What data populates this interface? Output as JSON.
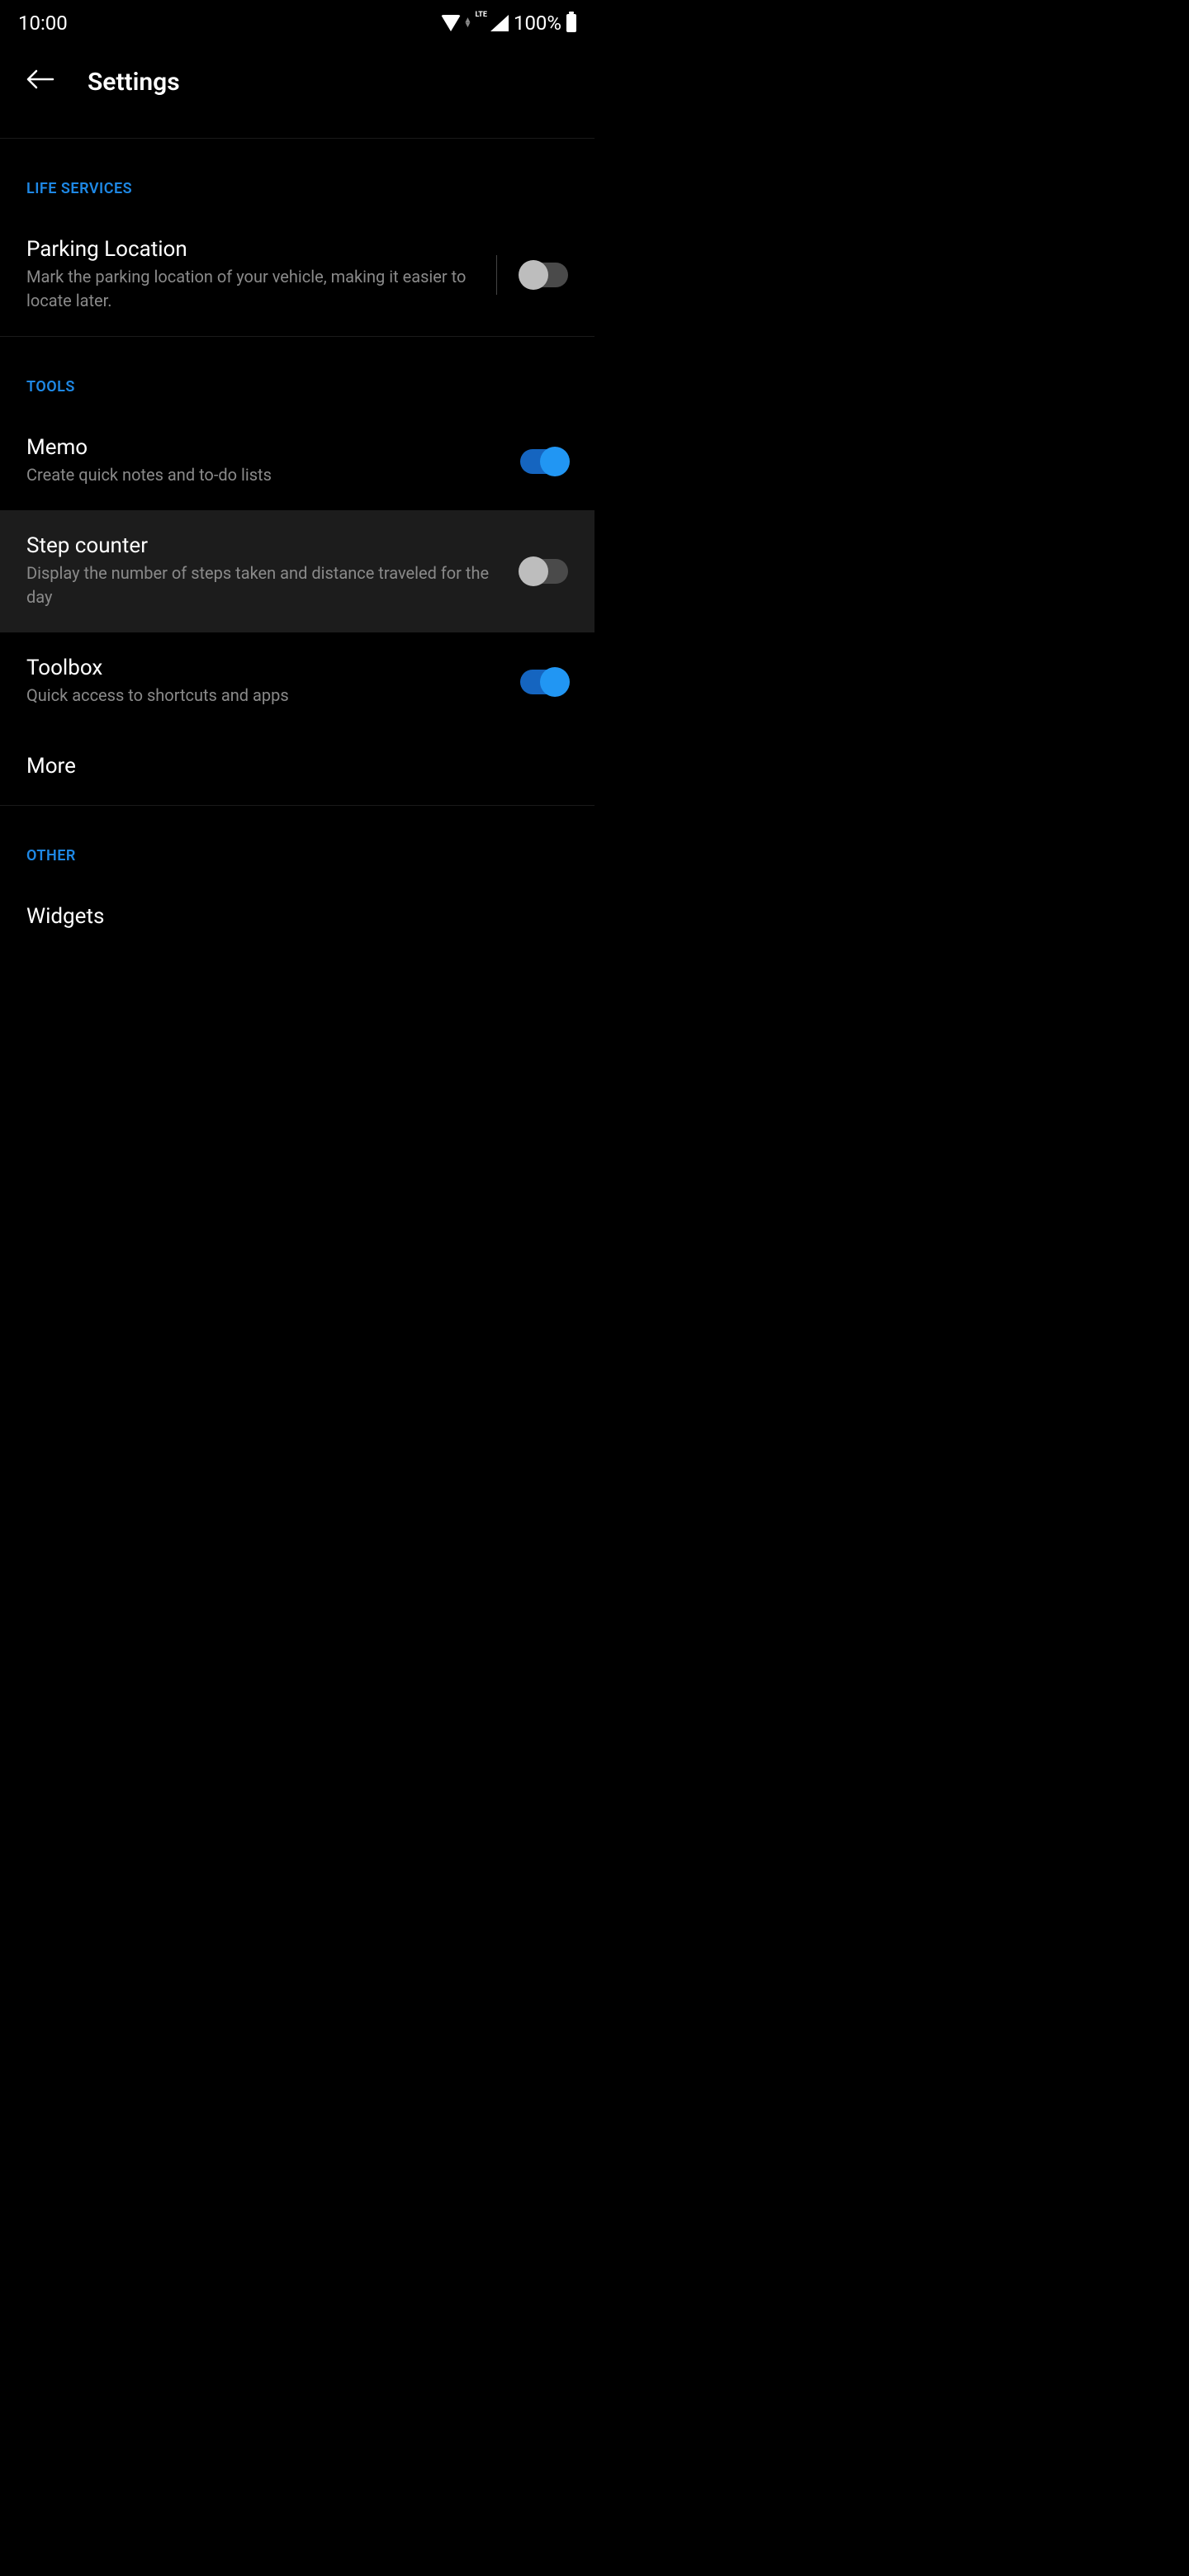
{
  "status": {
    "time": "10:00",
    "lte": "LTE",
    "battery": "100%"
  },
  "header": {
    "title": "Settings"
  },
  "sections": {
    "life": {
      "header": "LIFE SERVICES",
      "parking": {
        "title": "Parking Location",
        "desc": "Mark the parking location of your vehicle, making it easier to locate later."
      }
    },
    "tools": {
      "header": "TOOLS",
      "memo": {
        "title": "Memo",
        "desc": "Create quick notes and to-do lists"
      },
      "step": {
        "title": "Step counter",
        "desc": "Display the number of steps taken and distance traveled for the day"
      },
      "toolbox": {
        "title": "Toolbox",
        "desc": "Quick access to shortcuts and apps"
      },
      "more": {
        "title": "More"
      }
    },
    "other": {
      "header": "OTHER",
      "widgets": {
        "title": "Widgets"
      }
    }
  }
}
